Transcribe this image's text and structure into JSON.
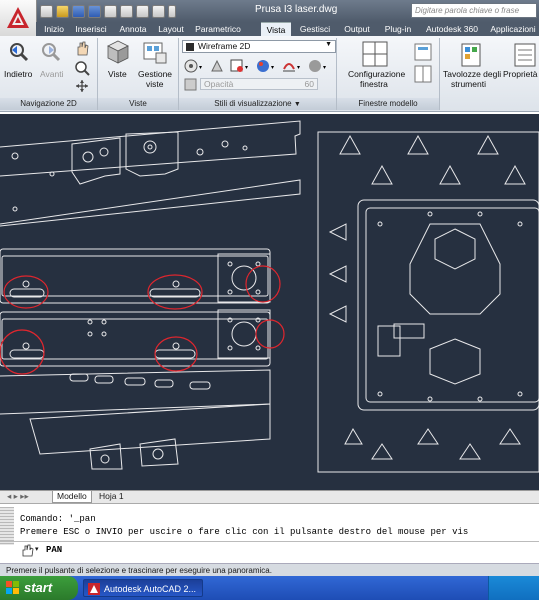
{
  "window": {
    "title": "Prusa I3 laser.dwg"
  },
  "search": {
    "placeholder": "Digitare parola chiave o frase"
  },
  "tabs": [
    {
      "label": "Inizio"
    },
    {
      "label": "Inserisci"
    },
    {
      "label": "Annota"
    },
    {
      "label": "Layout"
    },
    {
      "label": "Parametrico"
    },
    {
      "label": "Vista",
      "active": true
    },
    {
      "label": "Gestisci"
    },
    {
      "label": "Output"
    },
    {
      "label": "Plug-in"
    },
    {
      "label": "Autodesk 360"
    },
    {
      "label": "Applicazioni"
    }
  ],
  "ribbon": {
    "back_label": "Indietro",
    "forward_label": "Avanti",
    "views_label": "Viste",
    "view_manager_label_1": "Gestione",
    "view_manager_label_2": "viste",
    "visual_style_value": "Wireframe 2D",
    "opacity_label": "Opacità",
    "opacity_value": "60",
    "viewport_config_label_1": "Configurazione",
    "viewport_config_label_2": "finestra",
    "tool_palettes_label_1": "Tavolozze degli",
    "tool_palettes_label_2": "strumenti",
    "properties_label": "Proprietà",
    "panels": {
      "nav2d": "Navigazione 2D",
      "views": "Viste",
      "visual_styles": "Stili di visualizzazione",
      "viewports": "Finestre modello"
    }
  },
  "layout_tabs": [
    {
      "label": "Modello"
    },
    {
      "label": "Hoja 1"
    }
  ],
  "command": {
    "line1": "Comando: '_pan",
    "line2": "Premere ESC o INVIO per uscire o fare clic con il pulsante destro del mouse per vis",
    "input_value": "PAN"
  },
  "status_bar": {
    "text": "Premere il pulsante di selezione e trascinare per eseguire una panoramica."
  },
  "taskbar": {
    "start_label": "start",
    "item_label": "Autodesk AutoCAD 2..."
  },
  "colors": {
    "canvas": "#263040",
    "linework": "#e8e8ea",
    "annotation": "#e0262e",
    "titlebar": "#4f5b6b"
  }
}
